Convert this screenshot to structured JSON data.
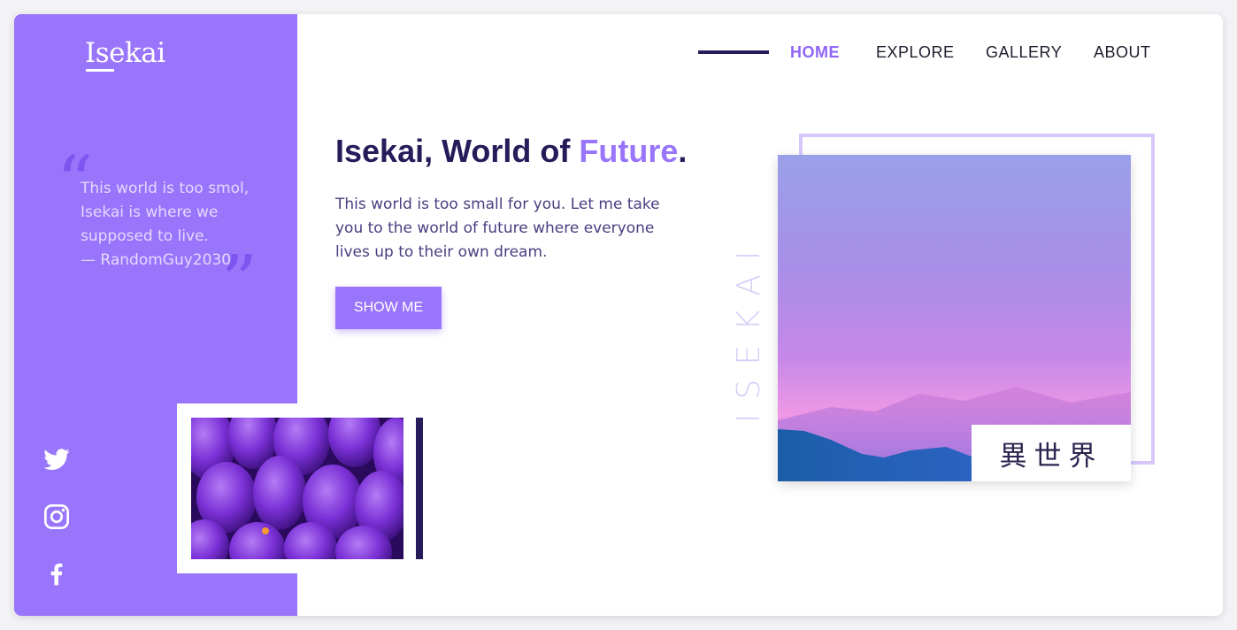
{
  "brand": {
    "logo_text": "Isekai"
  },
  "quote": {
    "open_mark": "“",
    "close_mark": "”",
    "lines": [
      "This world is too smol,",
      "Isekai is where we",
      "supposed to live."
    ],
    "author": "— RandomGuy2030"
  },
  "social": [
    {
      "icon": "twitter-icon"
    },
    {
      "icon": "instagram-icon"
    },
    {
      "icon": "facebook-icon"
    }
  ],
  "nav": {
    "items": [
      {
        "label": "HOME",
        "active": true
      },
      {
        "label": "EXPLORE",
        "active": false
      },
      {
        "label": "GALLERY",
        "active": false
      },
      {
        "label": "ABOUT",
        "active": false
      }
    ]
  },
  "hero": {
    "title_part1": "Isekai, World of ",
    "title_accent": "Future",
    "title_end": ".",
    "description": "This world is too small for you. Let me take you to the world of future where everyone lives up to their own dream.",
    "cta_label": "SHOW ME",
    "vertical_word": "ISEKAI",
    "kanji": "異世界"
  },
  "colors": {
    "brand_purple": "#9975fc",
    "dark_navy": "#271b5a",
    "light_lavender": "#d7c8fb"
  }
}
